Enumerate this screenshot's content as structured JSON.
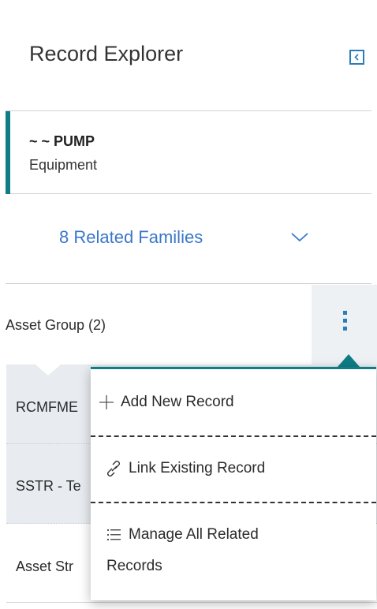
{
  "header": {
    "title": "Record Explorer",
    "collapse_icon": "chevron-left-icon"
  },
  "record": {
    "name": "~ ~ PUMP",
    "type": "Equipment",
    "accent_color": "#0f7c86"
  },
  "families": {
    "label": "8 Related Families",
    "icon": "chevron-down-icon",
    "color": "#3b78c9"
  },
  "group": {
    "label": "Asset Group  (2)",
    "menu_icon": "kebab-menu-icon"
  },
  "list": {
    "items": [
      {
        "label": "RCMFME"
      },
      {
        "label": "SSTR - Te"
      }
    ],
    "asset_str": {
      "label": "Asset Str"
    }
  },
  "popup": {
    "add": {
      "label": "Add New Record",
      "icon": "plus-icon"
    },
    "link": {
      "label": "Link Existing Record",
      "icon": "link-icon"
    },
    "manage": {
      "label_line1": "Manage All Related",
      "label_line2": "Records",
      "icon": "list-icon"
    }
  }
}
